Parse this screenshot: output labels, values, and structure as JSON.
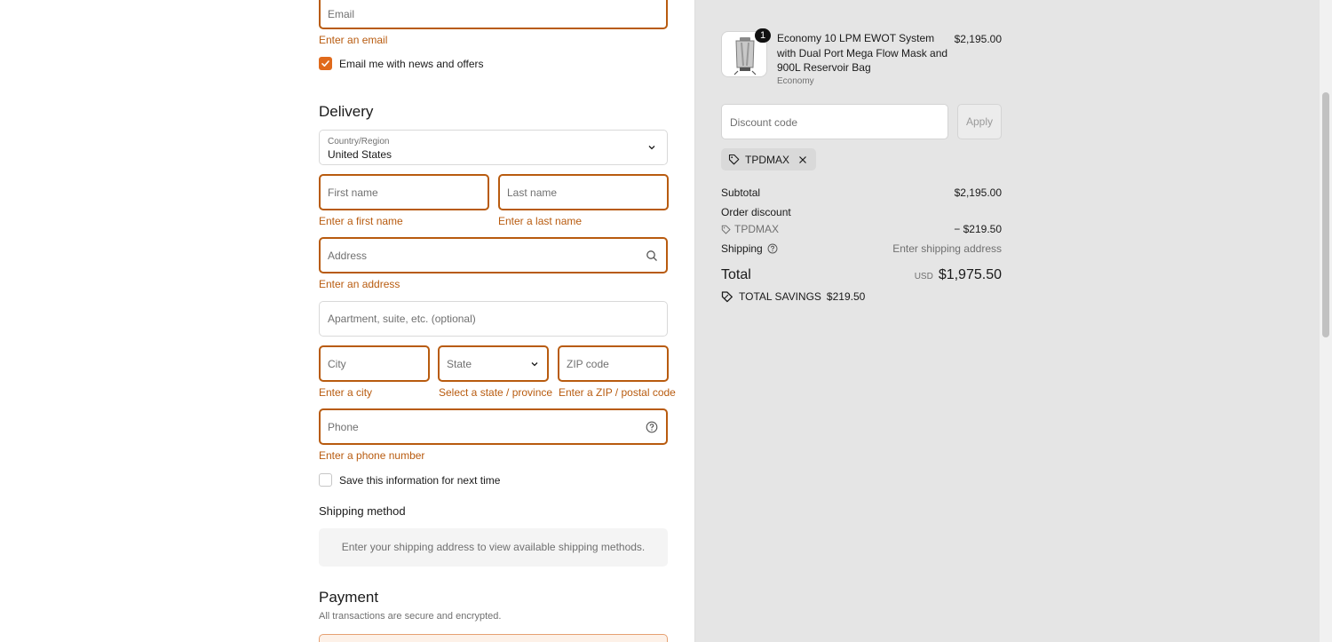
{
  "contact": {
    "email_placeholder": "Email",
    "email_error": "Enter an email",
    "news_label": "Email me with news and offers",
    "news_checked": true
  },
  "delivery": {
    "heading": "Delivery",
    "country_label": "Country/Region",
    "country_value": "United States",
    "first_name_placeholder": "First name",
    "first_name_error": "Enter a first name",
    "last_name_placeholder": "Last name",
    "last_name_error": "Enter a last name",
    "address_placeholder": "Address",
    "address_error": "Enter an address",
    "apartment_placeholder": "Apartment, suite, etc. (optional)",
    "city_placeholder": "City",
    "city_error": "Enter a city",
    "state_placeholder": "State",
    "state_error": "Select a state / province",
    "zip_placeholder": "ZIP code",
    "zip_error": "Enter a ZIP / postal code",
    "phone_placeholder": "Phone",
    "phone_error": "Enter a phone number",
    "save_info_label": "Save this information for next time",
    "save_info_checked": false
  },
  "shipping": {
    "heading": "Shipping method",
    "message": "Enter your shipping address to view available shipping methods."
  },
  "payment": {
    "heading": "Payment",
    "subtitle": "All transactions are secure and encrypted."
  },
  "summary": {
    "product": {
      "quantity": "1",
      "title": "Economy 10 LPM EWOT System with Dual Port Mega Flow Mask and 900L Reservoir Bag",
      "variant": "Economy",
      "price": "$2,195.00"
    },
    "discount_placeholder": "Discount code",
    "apply_label": "Apply",
    "applied_code": "TPDMAX",
    "subtotal_label": "Subtotal",
    "subtotal_value": "$2,195.00",
    "order_discount_label": "Order discount",
    "discount_code": "TPDMAX",
    "discount_value": "− $219.50",
    "shipping_label": "Shipping",
    "shipping_value": "Enter shipping address",
    "total_label": "Total",
    "total_currency": "USD",
    "total_value": "$1,975.50",
    "savings_label": "TOTAL SAVINGS",
    "savings_value": "$219.50"
  },
  "colors": {
    "error": "#b85b0f",
    "accent": "#e06a1c",
    "summary_bg": "#e5e5e5"
  }
}
